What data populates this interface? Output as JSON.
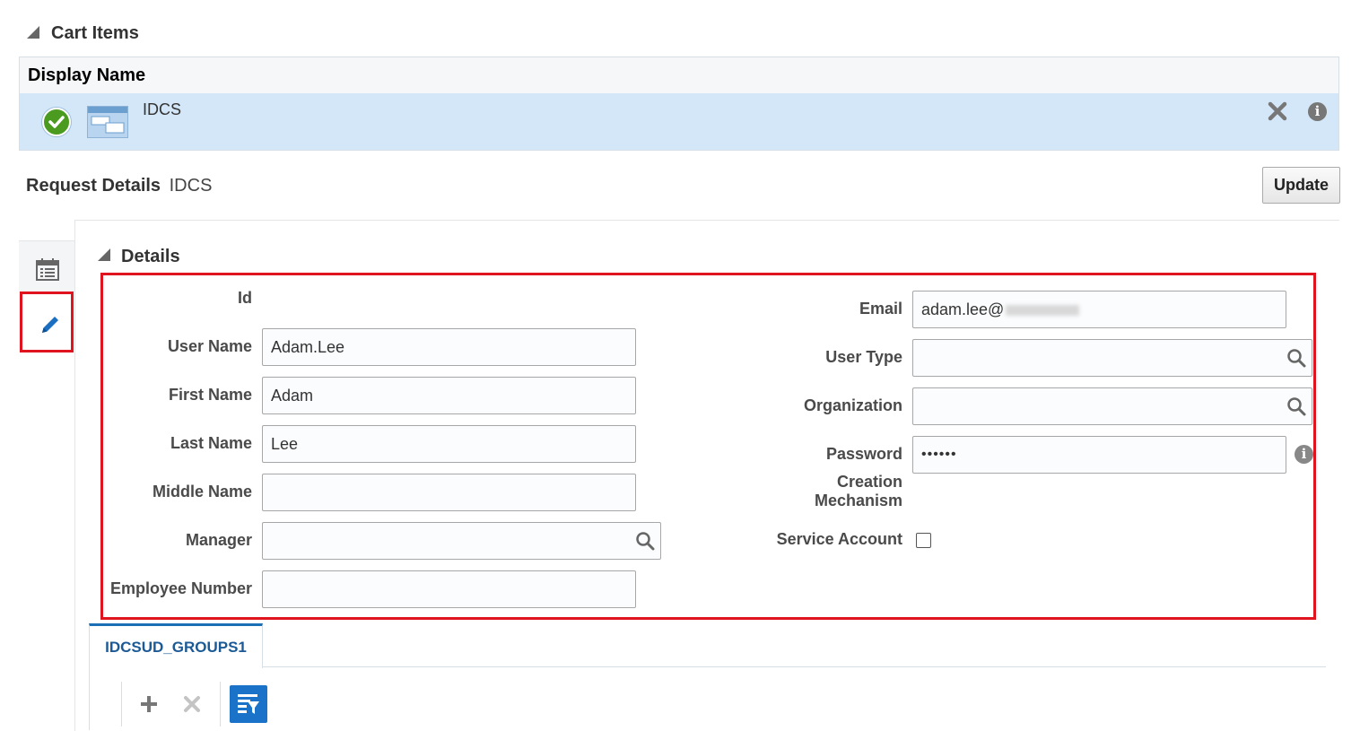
{
  "cart": {
    "title": "Cart Items",
    "column_header": "Display Name",
    "rows": [
      {
        "label": "IDCS",
        "status": "check-icon"
      }
    ]
  },
  "request": {
    "title": "Request Details",
    "name": "IDCS",
    "update_label": "Update"
  },
  "details": {
    "title": "Details",
    "left_fields": {
      "id_label": "Id",
      "user_name_label": "User Name",
      "user_name_value": "Adam.Lee",
      "first_name_label": "First Name",
      "first_name_value": "Adam",
      "last_name_label": "Last Name",
      "last_name_value": "Lee",
      "middle_name_label": "Middle Name",
      "middle_name_value": "",
      "manager_label": "Manager",
      "manager_value": "",
      "employee_number_label": "Employee Number",
      "employee_number_value": ""
    },
    "right_fields": {
      "email_label": "Email",
      "email_value": "adam.lee@",
      "user_type_label": "User Type",
      "user_type_value": "",
      "organization_label": "Organization",
      "organization_value": "",
      "password_label": "Password",
      "password_value": "••••••",
      "creation_label_1": "Creation",
      "creation_label_2": "Mechanism",
      "service_account_label": "Service Account",
      "service_account_checked": false
    }
  },
  "tabs": [
    {
      "label": "IDCSUD_GROUPS1",
      "active": true
    }
  ],
  "toolbar": {
    "add": "plus-icon",
    "remove": "close-icon",
    "filter": "filter-icon"
  },
  "colors": {
    "selected_row": "#d3e7f8",
    "highlight_border": "#e0141e",
    "tab_accent": "#1a6fb5",
    "filter_button": "#1a73c8",
    "check_green": "#4a9b1f"
  }
}
